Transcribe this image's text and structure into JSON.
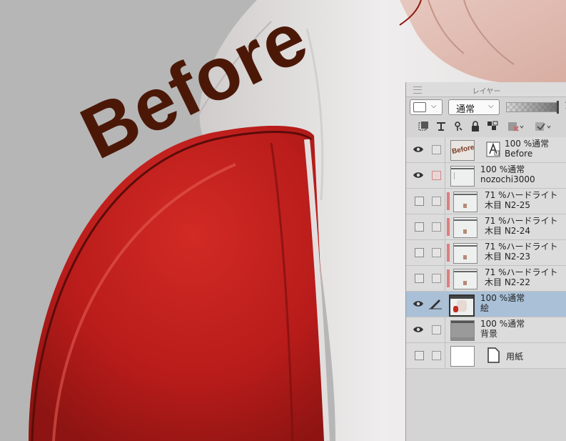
{
  "canvas": {
    "overlay_text": "Before",
    "overlay_color": "#4b1808",
    "background_color": "#b6b6b6"
  },
  "panel": {
    "title": "レイヤー",
    "color_dropdown": "white-swatch",
    "blend_mode": "通常",
    "opacity_percent": 100,
    "opacity_value": "1",
    "tools": [
      "new-raster-layer-icon",
      "merge-down-icon",
      "clip-layer-icon",
      "lock-icon",
      "lock-transparent-icon",
      "mask-icon",
      "mask-apply-icon"
    ],
    "layers": [
      {
        "opacity": "100 %",
        "blend": "通常",
        "name": "Before",
        "visible": true,
        "thumb": "text",
        "thumb_text": "Before",
        "selected": false
      },
      {
        "opacity": "100 %",
        "blend": "通常",
        "name": "nozochi3000",
        "visible": true,
        "thumb": "blank",
        "selected": false
      },
      {
        "opacity": "71 %",
        "blend": "ハードライト",
        "name": "木目 N2-25",
        "visible": false,
        "clip": true,
        "selected": false
      },
      {
        "opacity": "71 %",
        "blend": "ハードライト",
        "name": "木目 N2-24",
        "visible": false,
        "clip": true,
        "selected": false
      },
      {
        "opacity": "71 %",
        "blend": "ハードライト",
        "name": "木目 N2-23",
        "visible": false,
        "clip": true,
        "selected": false
      },
      {
        "opacity": "71 %",
        "blend": "ハードライト",
        "name": "木目 N2-22",
        "visible": false,
        "clip": true,
        "selected": false
      },
      {
        "opacity": "100 %",
        "blend": "通常",
        "name": "絵",
        "visible": true,
        "editing": true,
        "selected": true
      },
      {
        "opacity": "100 %",
        "blend": "通常",
        "name": "背景",
        "visible": true,
        "selected": false
      },
      {
        "name": "用紙",
        "visible": false,
        "paper": true,
        "selected": false
      }
    ]
  }
}
